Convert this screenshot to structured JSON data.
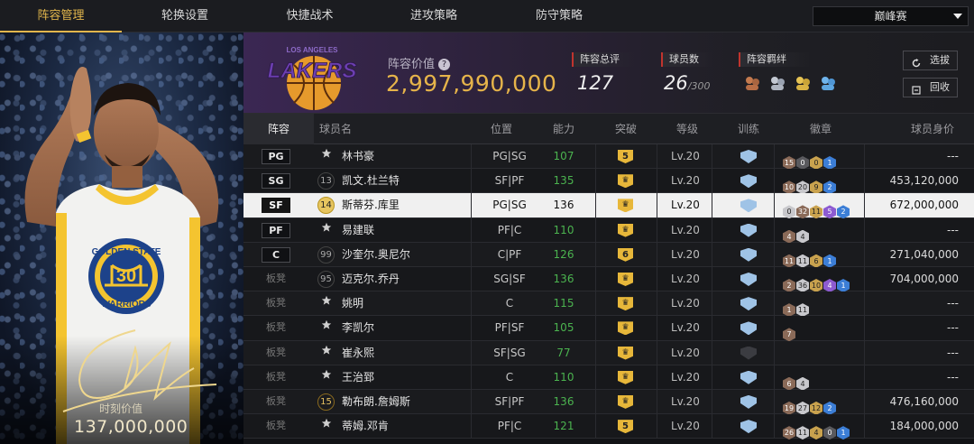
{
  "nav": {
    "tabs": [
      "阵容管理",
      "轮换设置",
      "快捷战术",
      "进攻策略",
      "防守策略"
    ],
    "active_tab": 0,
    "mode_select": "巅峰赛"
  },
  "card": {
    "value_label": "时刻价值",
    "value": "137,000,000",
    "jersey_team": "GOLDEN STATE",
    "jersey_number": "30",
    "jersey_bottom": "WARRIORS"
  },
  "header": {
    "logo_top": "LOS ANGELES",
    "logo_text": "LAKERS",
    "team_value_label": "阵容价值",
    "team_value": "2,997,990,000",
    "overall_label": "阵容总评",
    "overall_value": "127",
    "players_label": "球员数",
    "players_value": "26",
    "players_max": "/300",
    "synergy_label": "阵容羁绊",
    "synergy_icons": [
      "synergy-icon-1",
      "synergy-icon-2",
      "synergy-icon-3",
      "synergy-icon-4"
    ],
    "btn_select": "选拔",
    "btn_recycle": "回收"
  },
  "table": {
    "headers": [
      "阵容",
      "球员名",
      "位置",
      "能力",
      "突破",
      "等级",
      "训练",
      "徽章",
      "球员身价"
    ],
    "rows": [
      {
        "slot": "PG",
        "jersey": "★",
        "name": "林书豪",
        "pos": "PG|SG",
        "ability": "107",
        "break": "5",
        "level": "Lv.20",
        "train": "light",
        "badges": [
          [
            "15",
            "br"
          ],
          [
            "0",
            "gr"
          ],
          [
            "0",
            "gd"
          ],
          [
            "1",
            "bl"
          ]
        ],
        "worth": "---"
      },
      {
        "slot": "SG",
        "jersey": "13",
        "name": "凯文.杜兰特",
        "pos": "SF|PF",
        "ability": "135",
        "break": "crown",
        "level": "Lv.20",
        "train": "light",
        "badges": [
          [
            "10",
            "br"
          ],
          [
            "20",
            "sv"
          ],
          [
            "9",
            "gd"
          ],
          [
            "2",
            "bl"
          ]
        ],
        "worth": "453,120,000"
      },
      {
        "slot": "SF",
        "jersey": "14",
        "name": "斯蒂芬.库里",
        "pos": "PG|SG",
        "ability": "136",
        "break": "crown",
        "level": "Lv.20",
        "train": "light",
        "badges": [
          [
            "0",
            "sv"
          ],
          [
            "32",
            "br"
          ],
          [
            "11",
            "gd"
          ],
          [
            "5",
            "ht"
          ],
          [
            "2",
            "bl"
          ]
        ],
        "worth": "672,000,000",
        "selected": true
      },
      {
        "slot": "PF",
        "jersey": "★",
        "name": "易建联",
        "pos": "PF|C",
        "ability": "110",
        "break": "crown",
        "level": "Lv.20",
        "train": "light",
        "badges": [
          [
            "4",
            "br"
          ],
          [
            "4",
            "sv"
          ]
        ],
        "worth": "---"
      },
      {
        "slot": "C",
        "jersey": "99",
        "name": "沙奎尔.奥尼尔",
        "pos": "C|PF",
        "ability": "126",
        "break": "6",
        "level": "Lv.20",
        "train": "light",
        "badges": [
          [
            "11",
            "br"
          ],
          [
            "11",
            "sv"
          ],
          [
            "6",
            "gd"
          ],
          [
            "1",
            "bl"
          ]
        ],
        "worth": "271,040,000"
      },
      {
        "slot": "板凳",
        "jersey": "95",
        "name": "迈克尔.乔丹",
        "pos": "SG|SF",
        "ability": "136",
        "break": "crown",
        "level": "Lv.20",
        "train": "light",
        "badges": [
          [
            "2",
            "br"
          ],
          [
            "36",
            "sv"
          ],
          [
            "10",
            "gd"
          ],
          [
            "4",
            "ht"
          ],
          [
            "1",
            "bl"
          ]
        ],
        "worth": "704,000,000"
      },
      {
        "slot": "板凳",
        "jersey": "★",
        "name": "姚明",
        "pos": "C",
        "ability": "115",
        "break": "crown",
        "level": "Lv.20",
        "train": "light",
        "badges": [
          [
            "1",
            "br"
          ],
          [
            "11",
            "sv"
          ]
        ],
        "worth": "---"
      },
      {
        "slot": "板凳",
        "jersey": "★",
        "name": "李凯尔",
        "pos": "PF|SF",
        "ability": "105",
        "break": "crown",
        "level": "Lv.20",
        "train": "light",
        "badges": [
          [
            "7",
            "br"
          ]
        ],
        "worth": "---"
      },
      {
        "slot": "板凳",
        "jersey": "★",
        "name": "崔永熙",
        "pos": "SF|SG",
        "ability": "77",
        "break": "crown",
        "level": "Lv.20",
        "train": "dark",
        "badges": [],
        "worth": "---"
      },
      {
        "slot": "板凳",
        "jersey": "★",
        "name": "王治郅",
        "pos": "C",
        "ability": "110",
        "break": "crown",
        "level": "Lv.20",
        "train": "light",
        "badges": [
          [
            "6",
            "br"
          ],
          [
            "4",
            "sv"
          ]
        ],
        "worth": "---"
      },
      {
        "slot": "板凳",
        "jersey": "15",
        "name": "勒布朗.詹姆斯",
        "pos": "SF|PF",
        "ability": "136",
        "break": "crown",
        "level": "Lv.20",
        "train": "light",
        "badges": [
          [
            "19",
            "br"
          ],
          [
            "27",
            "sv"
          ],
          [
            "12",
            "gd"
          ],
          [
            "2",
            "bl"
          ]
        ],
        "worth": "476,160,000"
      },
      {
        "slot": "板凳",
        "jersey": "★",
        "name": "蒂姆.邓肯",
        "pos": "PF|C",
        "ability": "121",
        "break": "5",
        "level": "Lv.20",
        "train": "light",
        "badges": [
          [
            "26",
            "br"
          ],
          [
            "11",
            "sv"
          ],
          [
            "4",
            "gd"
          ],
          [
            "0",
            "gr"
          ],
          [
            "1",
            "bl"
          ]
        ],
        "worth": "184,000,000"
      }
    ]
  }
}
